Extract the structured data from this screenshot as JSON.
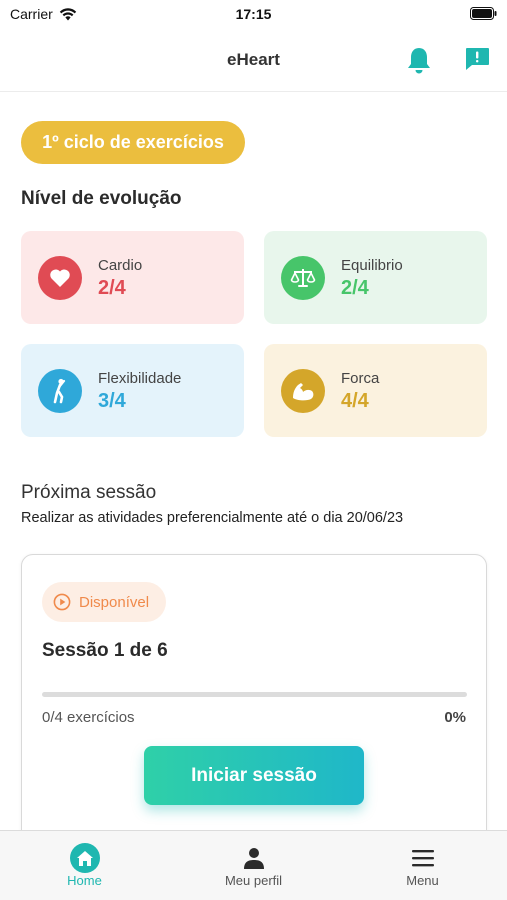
{
  "status_bar": {
    "carrier": "Carrier",
    "time": "17:15"
  },
  "nav": {
    "title": "eHeart",
    "icons": [
      "bell-icon",
      "chat-alert-icon"
    ],
    "accent_color": "#1fb7b0"
  },
  "cycle": {
    "label": "1º ciclo de exercícios",
    "color": "#ebbe3e"
  },
  "evolution": {
    "title": "Nível de evolução",
    "cards": [
      {
        "label": "Cardio",
        "value": "2/4",
        "icon": "heart-icon",
        "color": "#e04b54"
      },
      {
        "label": "Equilibrio",
        "value": "2/4",
        "icon": "scale-icon",
        "color": "#47c56a"
      },
      {
        "label": "Flexibilidade",
        "value": "3/4",
        "icon": "stretch-icon",
        "color": "#2fa8d9"
      },
      {
        "label": "Forca",
        "value": "4/4",
        "icon": "muscle-arm-icon",
        "color": "#d4a62a"
      }
    ]
  },
  "next_session": {
    "title": "Próxima sessão",
    "subtitle": "Realizar as atividades preferencialmente até o dia 20/06/23",
    "badge": "Disponível",
    "session_title": "Sessão 1 de 6",
    "progress_label": "0/4 exercícios",
    "progress_percent_text": "0%",
    "progress_fraction": 0,
    "button_label": "Iniciar sessão"
  },
  "tab_bar": {
    "tabs": [
      {
        "label": "Home",
        "icon": "home-icon",
        "active": true
      },
      {
        "label": "Meu perfil",
        "icon": "person-icon",
        "active": false
      },
      {
        "label": "Menu",
        "icon": "hamburger-menu-icon",
        "active": false
      }
    ]
  }
}
